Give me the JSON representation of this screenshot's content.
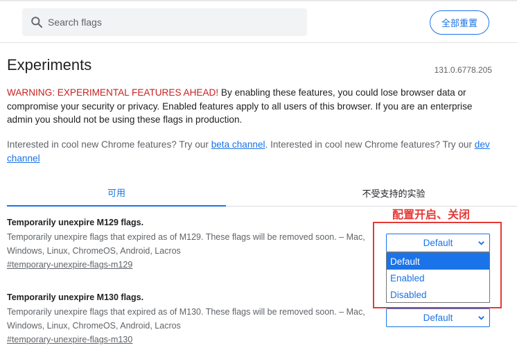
{
  "header": {
    "search_placeholder": "Search flags",
    "reset_label": "全部重置"
  },
  "page": {
    "title": "Experiments",
    "version": "131.0.6778.205"
  },
  "warning": {
    "label": "WARNING: EXPERIMENTAL FEATURES AHEAD!",
    "text": " By enabling these features, you could lose browser data or compromise your security or privacy. Enabled features apply to all users of this browser. If you are an enterprise admin you should not be using these flags in production."
  },
  "interested": {
    "text1": "Interested in cool new Chrome features? Try our ",
    "beta_link": "beta channel",
    "text2": ". Interested in cool new Chrome features? Try our ",
    "dev_link": "dev channel"
  },
  "tabs": [
    {
      "label": "可用",
      "active": true
    },
    {
      "label": "不受支持的实验",
      "active": false
    }
  ],
  "flags": [
    {
      "title": "Temporarily unexpire M129 flags.",
      "desc_line1": "Temporarily unexpire flags that expired as of M129. These flags will be removed soon. – Mac,",
      "desc_line2": "Windows, Linux, ChromeOS, Android, Lacros",
      "link": "#temporary-unexpire-flags-m129",
      "value": "Default"
    },
    {
      "title": "Temporarily unexpire M130 flags.",
      "desc_line1": "Temporarily unexpire flags that expired as of M130. These flags will be removed soon. – Mac,",
      "desc_line2": "Windows, Linux, ChromeOS, Android, Lacros",
      "link": "#temporary-unexpire-flags-m130",
      "value": "Default"
    }
  ],
  "dropdown": {
    "options": [
      "Default",
      "Enabled",
      "Disabled"
    ],
    "selected": "Default"
  },
  "annotation": {
    "text": "配置开启、关闭",
    "color": "#e53935"
  },
  "colors": {
    "accent": "#1a73e8",
    "warning": "#c5221f"
  }
}
